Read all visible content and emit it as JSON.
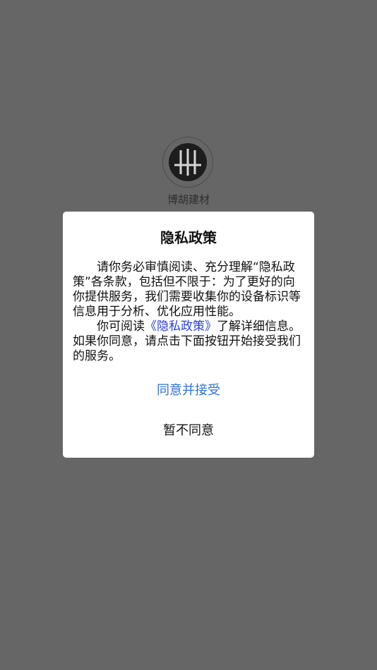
{
  "app": {
    "name": "博胡建材"
  },
  "dialog": {
    "title": "隐私政策",
    "paragraph1": "请你务必审慎阅读、充分理解“隐私政策”各条款，包括但不限于：为了更好的向你提供服务，我们需要收集你的设备标识等信息用于分析、优化应用性能。",
    "paragraph2_prefix": "你可阅读",
    "paragraph2_link": "《隐私政策》",
    "paragraph2_suffix": "了解详细信息。如果你同意，请点击下面按钮开始接受我们的服务。",
    "accept_label": "同意并接受",
    "decline_label": "暂不同意"
  },
  "colors": {
    "overlay": "#666666",
    "dialog_bg": "#ffffff",
    "link": "#2b3fd6",
    "accept": "#2f73d2",
    "text": "#111111"
  }
}
